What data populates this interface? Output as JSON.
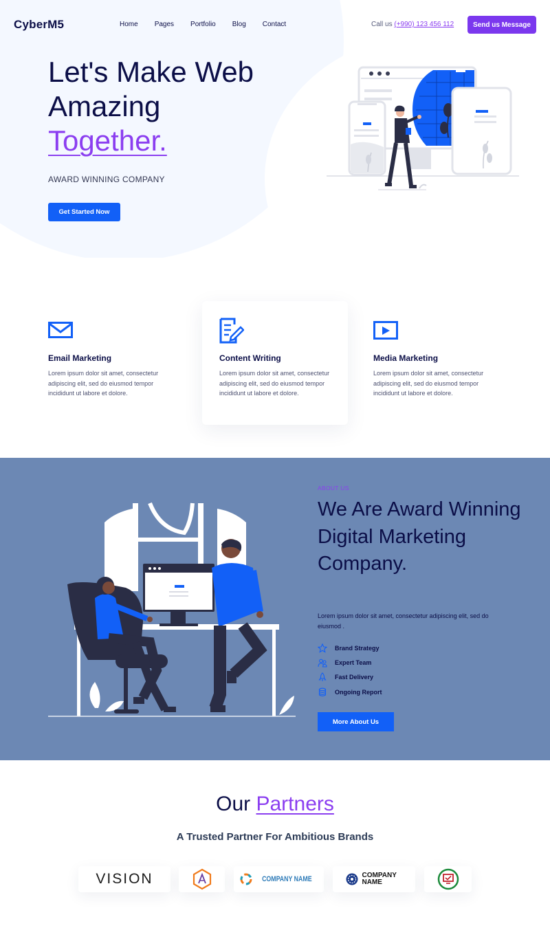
{
  "header": {
    "logo": "CyberM5",
    "nav": [
      "Home",
      "Pages",
      "Portfolio",
      "Blog",
      "Contact"
    ],
    "call_label": "Call us",
    "phone": "(+990) 123 456 112",
    "send_button": "Send us Message"
  },
  "hero": {
    "title_line1": "Let's Make Web",
    "title_line2": "Amazing",
    "title_accent": "Together.",
    "subtitle": "AWARD WINNING COMPANY",
    "cta": "Get Started Now"
  },
  "services": [
    {
      "title": "Email Marketing",
      "text": "Lorem ipsum dolor sit amet, consectetur adipiscing elit, sed do eiusmod tempor incididunt ut labore et dolore.",
      "icon": "envelope-icon"
    },
    {
      "title": "Content Writing",
      "text": "Lorem ipsum dolor sit amet, consectetur adipiscing elit, sed do eiusmod tempor incididunt ut labore et dolore.",
      "icon": "edit-document-icon"
    },
    {
      "title": "Media Marketing",
      "text": "Lorem ipsum dolor sit amet, consectetur adipiscing elit, sed do eiusmod tempor incididunt ut labore et dolore.",
      "icon": "play-icon"
    }
  ],
  "about": {
    "kicker": "ABOUT US",
    "title": "We Are Award Winning Digital Marketing Company.",
    "description": "Lorem ipsum dolor sit amet, consectetur adipiscing elit, sed do eiusmod .",
    "features": [
      {
        "label": "Brand Strategy",
        "icon": "star-icon"
      },
      {
        "label": "Expert Team",
        "icon": "team-icon"
      },
      {
        "label": "Fast Delivery",
        "icon": "rocket-icon"
      },
      {
        "label": "Ongoing Report",
        "icon": "database-icon"
      }
    ],
    "cta": "More About Us"
  },
  "partners": {
    "title_plain": "Our",
    "title_accent": "Partners",
    "subtitle": "A Trusted Partner For Ambitious Brands",
    "brands": [
      "VISION",
      "",
      "COMPANY NAME",
      "COMPANY NAME",
      ""
    ]
  },
  "colors": {
    "primary_blue": "#1260f7",
    "accent_purple": "#8b3ef0",
    "navy_text": "#0b0e47",
    "about_bg": "#6c88b4"
  }
}
